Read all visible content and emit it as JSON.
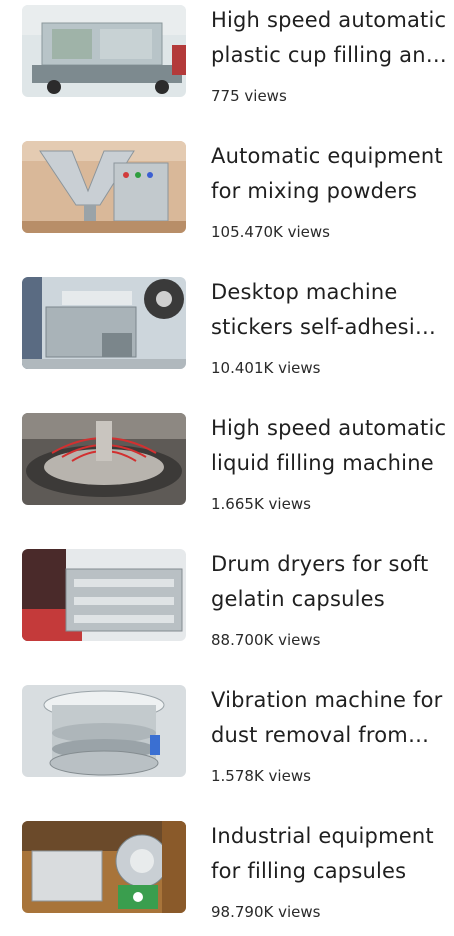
{
  "videos": [
    {
      "title": "High speed automatic plastic cup filling and sealing machine",
      "views": "775 views",
      "thumb_tone": "#c9d3d6"
    },
    {
      "title": "Automatic equipment for mixing powders",
      "views": "105.470K views",
      "thumb_tone": "#c9a78a"
    },
    {
      "title": "Desktop machine stickers self-adhesive labels",
      "views": "10.401K views",
      "thumb_tone": "#aab8c2"
    },
    {
      "title": "High speed automatic liquid filling machine",
      "views": "1.665K views",
      "thumb_tone": "#6e6a66"
    },
    {
      "title": "Drum dryers for soft gelatin capsules",
      "views": "88.700K views",
      "thumb_tone": "#8c3a3a"
    },
    {
      "title": "Vibration machine for dust removal from tablets",
      "views": "1.578K views",
      "thumb_tone": "#c4ccd2"
    },
    {
      "title": "Industrial equipment for filling capsules",
      "views": "98.790K views",
      "thumb_tone": "#b07a3a"
    }
  ]
}
